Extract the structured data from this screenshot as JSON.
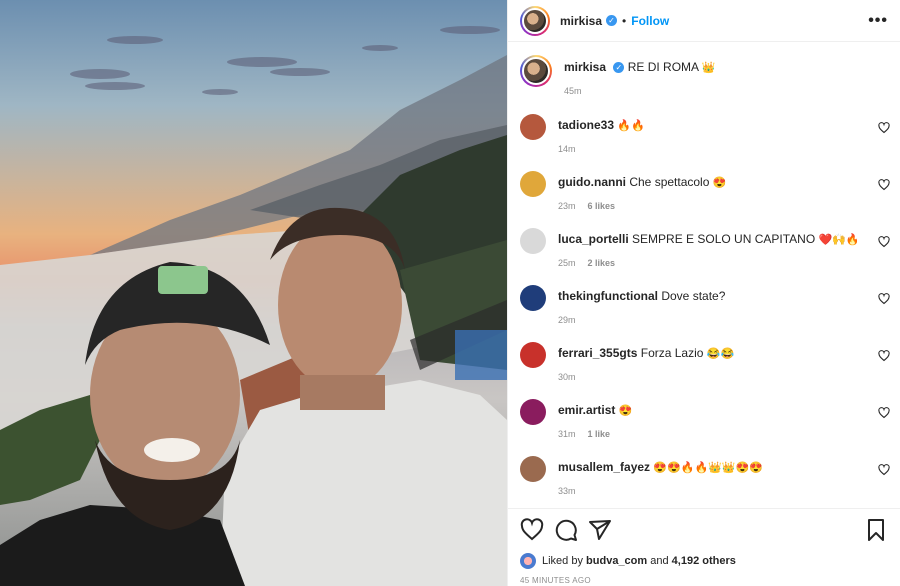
{
  "post": {
    "author": "mirkisa",
    "follow_label": "Follow",
    "dot": "•",
    "more_label": "•••"
  },
  "caption": {
    "username": "mirkisa",
    "text": "RE DI ROMA",
    "emoji": "👑",
    "time": "45m"
  },
  "comments": [
    {
      "username": "tadione33",
      "text": "",
      "emoji": "🔥🔥",
      "time": "14m",
      "likes": "",
      "avatar_color": "#b5583d"
    },
    {
      "username": "guido.nanni",
      "text": "Che spettacolo",
      "emoji": "😍",
      "time": "23m",
      "likes": "6 likes",
      "avatar_color": "#e0a73a"
    },
    {
      "username": "luca_portelli",
      "text": "SEMPRE E SOLO UN CAPITANO",
      "emoji": "❤️🙌🔥",
      "time": "25m",
      "likes": "2 likes",
      "avatar_color": "#d9d9d9"
    },
    {
      "username": "thekingfunctional",
      "text": "Dove state?",
      "emoji": "",
      "time": "29m",
      "likes": "",
      "avatar_color": "#1f3d7a"
    },
    {
      "username": "ferrari_355gts",
      "text": "Forza Lazio",
      "emoji": "😂😂",
      "time": "30m",
      "likes": "",
      "avatar_color": "#c8312b"
    },
    {
      "username": "emir.artist",
      "text": "",
      "emoji": "😍",
      "time": "31m",
      "likes": "1 like",
      "avatar_color": "#8a1c5e"
    },
    {
      "username": "musallem_fayez",
      "text": "",
      "emoji": "😍😍🔥🔥👑👑😍😍",
      "time": "33m",
      "likes": "",
      "avatar_color": "#9a6a4f"
    }
  ],
  "engagement": {
    "liked_prefix": "Liked by",
    "liked_user": "budva_com",
    "liked_and": "and",
    "liked_others": "4,192 others",
    "timestamp": "45 MINUTES AGO"
  },
  "icons": [
    "heart-icon",
    "comment-icon",
    "share-icon",
    "bookmark-icon",
    "more-icon",
    "verified-icon"
  ]
}
